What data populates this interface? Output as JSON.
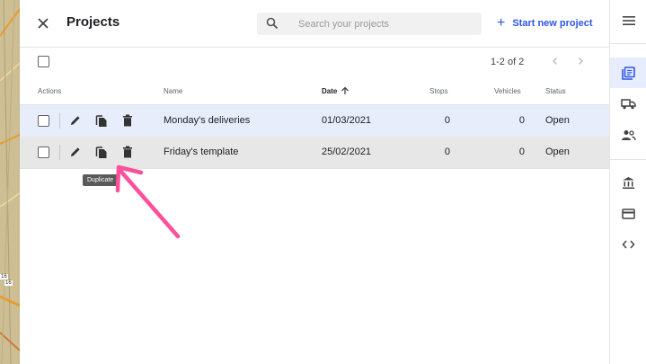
{
  "header": {
    "title": "Projects",
    "search_placeholder": "Search your projects",
    "new_project_label": "Start new project"
  },
  "pagination": {
    "range_text": "1-2 of 2"
  },
  "table": {
    "columns": [
      "Actions",
      "Name",
      "Date",
      "Stops",
      "Vehicles",
      "Status"
    ],
    "sorted_column": "Date",
    "rows": [
      {
        "name": "Monday's deliveries",
        "date": "01/03/2021",
        "stops": "0",
        "vehicles": "0",
        "status": "Open"
      },
      {
        "name": "Friday's template",
        "date": "25/02/2021",
        "stops": "0",
        "vehicles": "0",
        "status": "Open"
      }
    ]
  },
  "tooltip": {
    "text": "Duplicate"
  },
  "map_labels": {
    "road_a": "16",
    "road_b": "16"
  },
  "colors": {
    "accent": "#2e55e6",
    "annotation": "#ff4f9a",
    "selected_row": "#e8edfc",
    "hover_row": "#e7e7e7"
  },
  "icons": [
    "close-icon",
    "search-icon",
    "add-icon",
    "chevron-left-icon",
    "chevron-right-icon",
    "arrow-up-icon",
    "edit-icon",
    "duplicate-icon",
    "delete-icon",
    "menu-icon",
    "projects-icon",
    "truck-icon",
    "people-icon",
    "bank-icon",
    "card-icon",
    "code-icon"
  ]
}
